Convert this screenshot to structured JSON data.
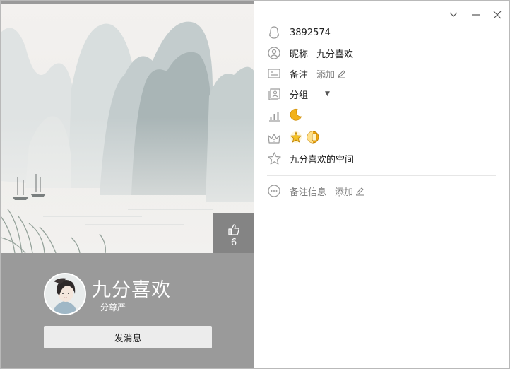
{
  "profile": {
    "nickname": "九分喜欢",
    "signature": "一分尊严",
    "likes": "6",
    "send_message_label": "发消息"
  },
  "details": {
    "qq_number": "3892574",
    "nickname_label": "昵称",
    "nickname_value": "九分喜欢",
    "remark_label": "备注",
    "remark_add": "添加",
    "group_label": "分组",
    "space_link": "九分喜欢的空间",
    "remark_info_label": "备注信息",
    "remark_info_add": "添加"
  },
  "icons": {
    "level": "moon-icon",
    "vip_badges": [
      "star-badge-icon",
      "sun-badge-icon"
    ]
  },
  "colors": {
    "left_panel_bg": "#9a9a9a",
    "like_bg": "#848484",
    "icon_gray": "#9a9a9a",
    "badge_gold": "#f2b11a"
  }
}
